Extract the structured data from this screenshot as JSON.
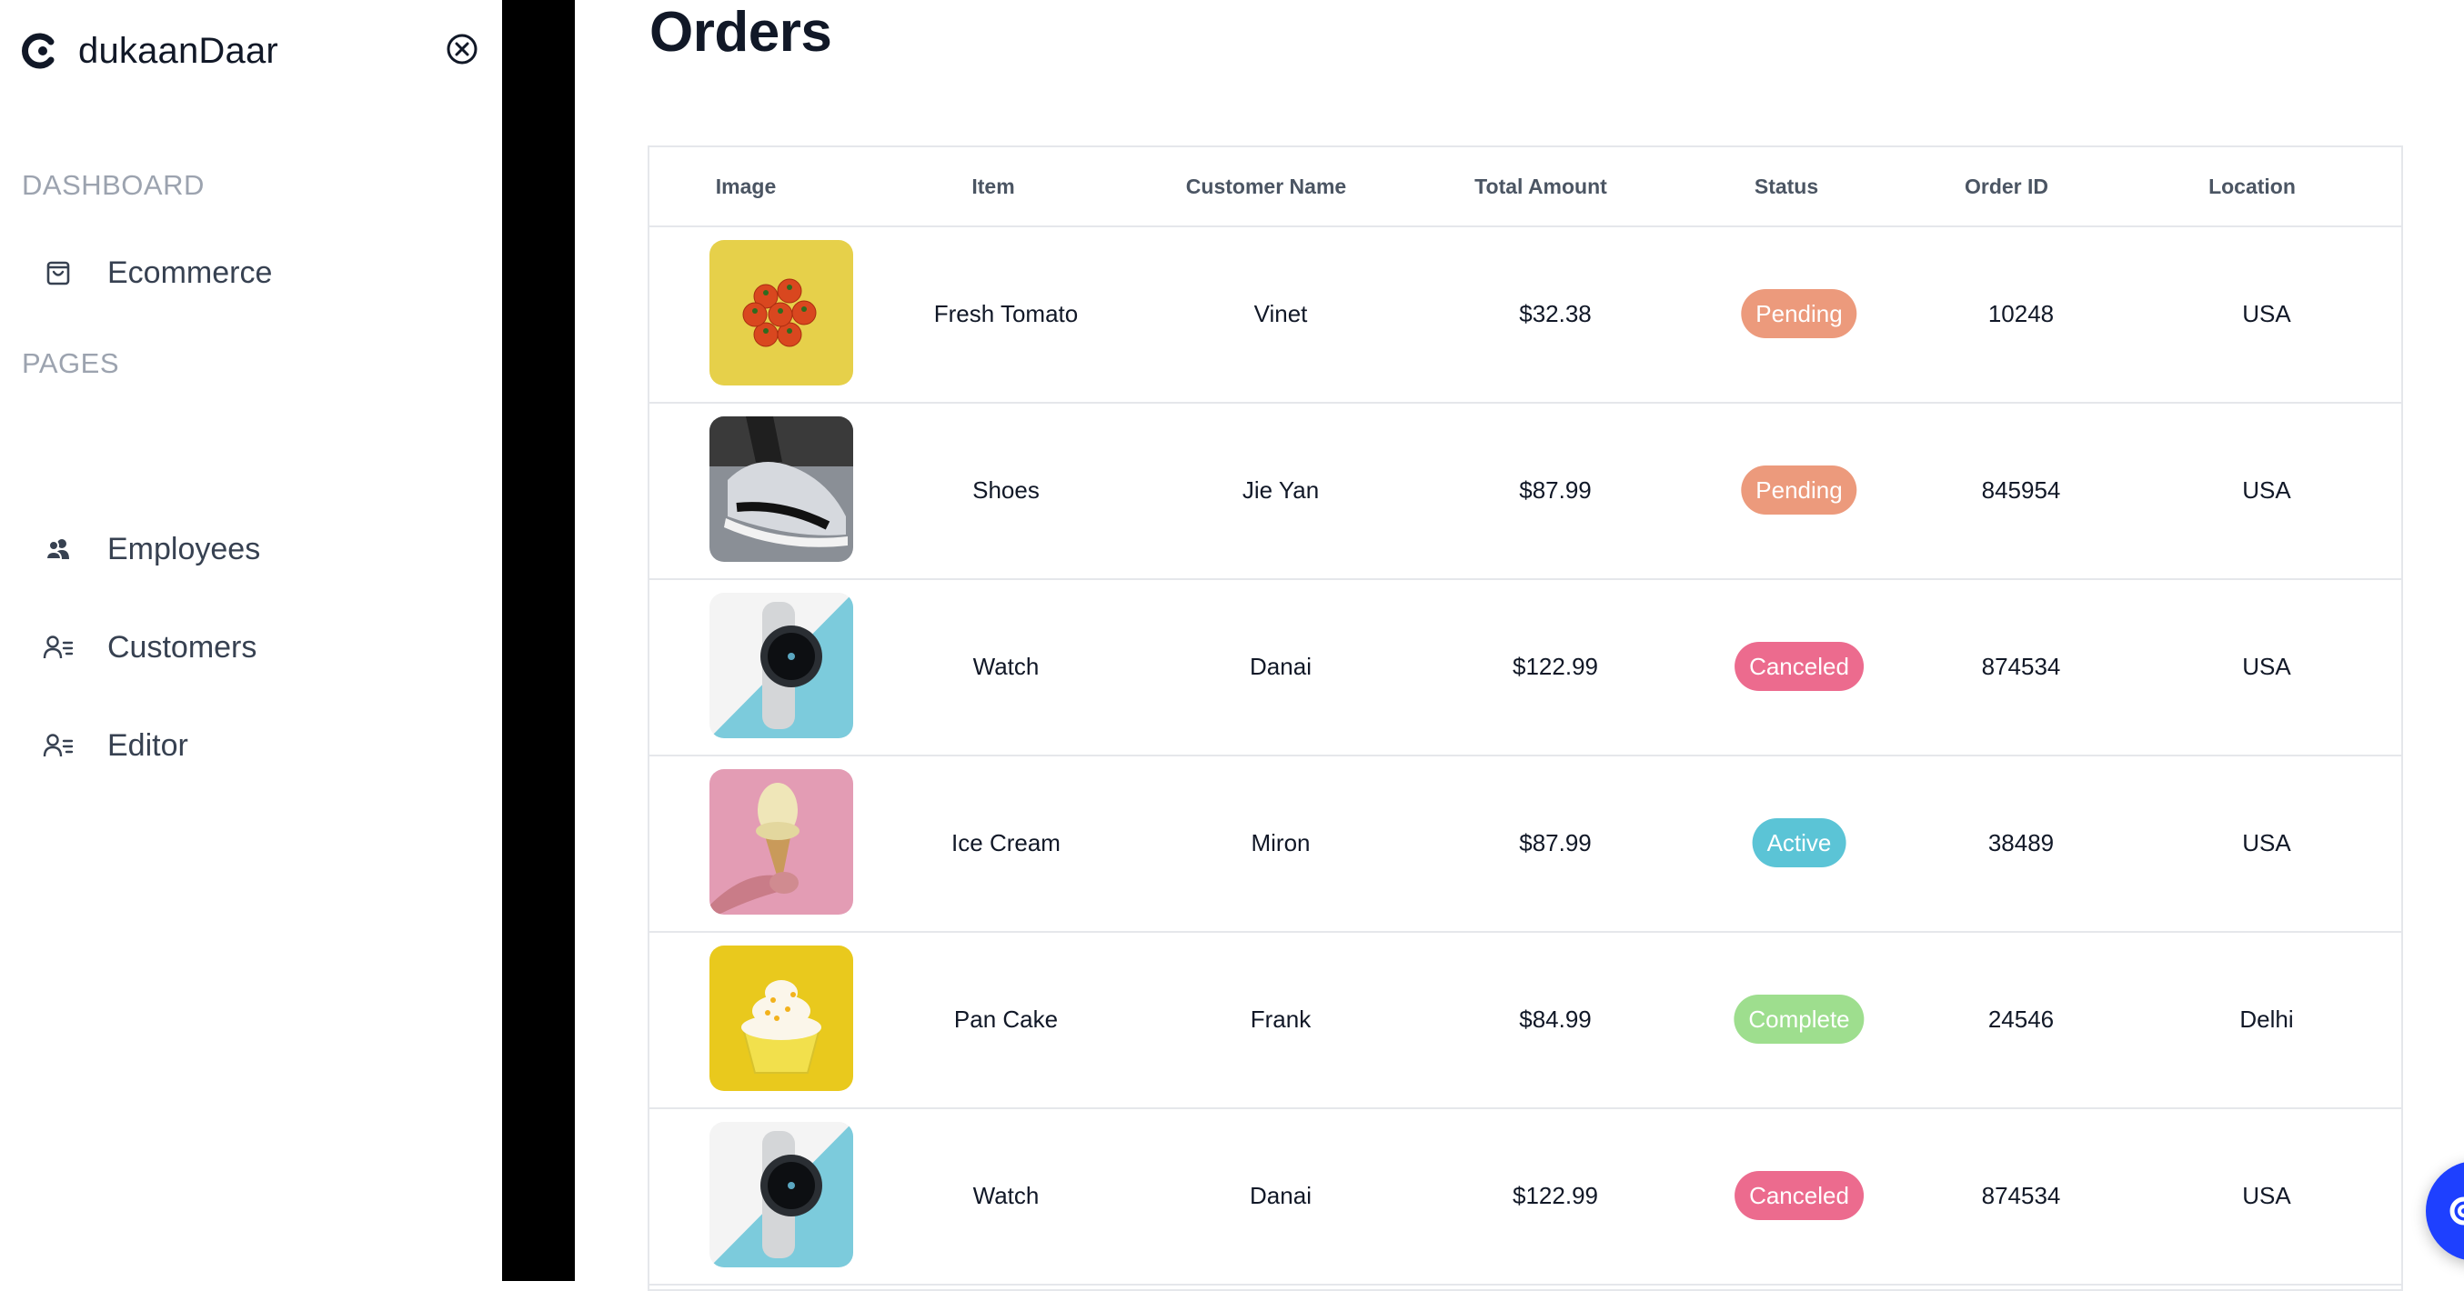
{
  "sidebar": {
    "brand": "dukaanDaar",
    "sections": [
      {
        "title": "DASHBOARD",
        "items": [
          {
            "label": "Ecommerce",
            "icon": "shopping-bag-icon"
          }
        ]
      },
      {
        "title": "PAGES",
        "items": [
          {
            "label": "Employees",
            "icon": "users-icon"
          },
          {
            "label": "Customers",
            "icon": "user-list-icon"
          },
          {
            "label": "Editor",
            "icon": "user-list-icon"
          }
        ]
      }
    ]
  },
  "main": {
    "title": "Orders",
    "table": {
      "columns": [
        "Image",
        "Item",
        "Customer Name",
        "Total Amount",
        "Status",
        "Order ID",
        "Location"
      ],
      "rows": [
        {
          "item": "Fresh Tomato",
          "customer": "Vinet",
          "amount": "$32.38",
          "status": "Pending",
          "order_id": "10248",
          "location": "USA",
          "image": "tomato-image",
          "status_color": "#ec9a7c"
        },
        {
          "item": "Shoes",
          "customer": "Jie Yan",
          "amount": "$87.99",
          "status": "Pending",
          "order_id": "845954",
          "location": "USA",
          "image": "shoes-image",
          "status_color": "#ec9a7c"
        },
        {
          "item": "Watch",
          "customer": "Danai",
          "amount": "$122.99",
          "status": "Canceled",
          "order_id": "874534",
          "location": "USA",
          "image": "watch-image",
          "status_color": "#ec6b8e"
        },
        {
          "item": "Ice Cream",
          "customer": "Miron",
          "amount": "$87.99",
          "status": "Active",
          "order_id": "38489",
          "location": "USA",
          "image": "ice-cream-image",
          "status_color": "#5bc4d6"
        },
        {
          "item": "Pan Cake",
          "customer": "Frank",
          "amount": "$84.99",
          "status": "Complete",
          "order_id": "24546",
          "location": "Delhi",
          "image": "cupcake-image",
          "status_color": "#9ede8e"
        },
        {
          "item": "Watch",
          "customer": "Danai",
          "amount": "$122.99",
          "status": "Canceled",
          "order_id": "874534",
          "location": "USA",
          "image": "watch-image",
          "status_color": "#ec6b8e"
        }
      ]
    }
  },
  "colors": {
    "accent": "#1e40ff",
    "pending": "#ec9a7c",
    "canceled": "#ec6b8e",
    "active": "#5bc4d6",
    "complete": "#9ede8e"
  }
}
